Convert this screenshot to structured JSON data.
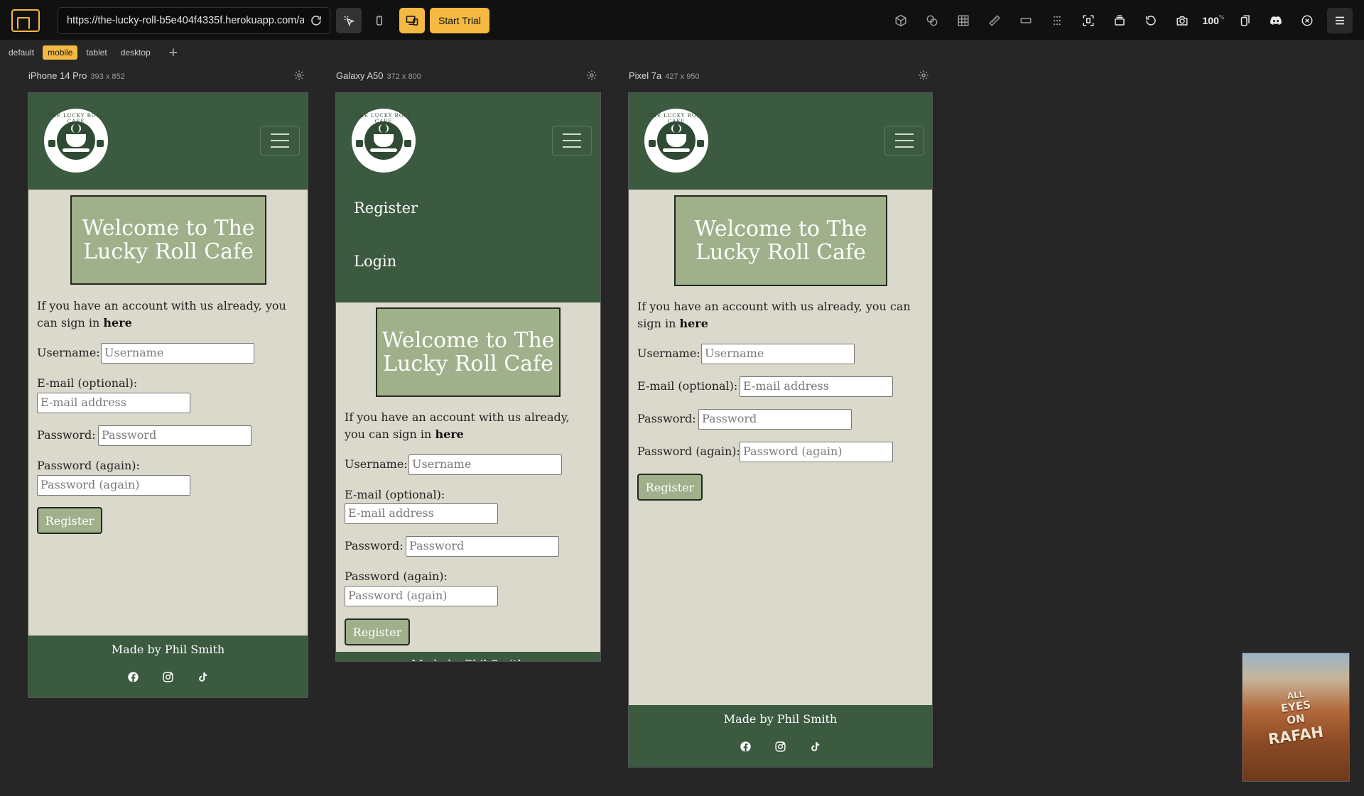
{
  "toolbar": {
    "url": "https://the-lucky-roll-b5e404f4335f.herokuapp.com/a",
    "start_trial": "Start Trial",
    "zoom": "100",
    "zoom_unit": "%"
  },
  "tabs": [
    {
      "label": "default",
      "active": false
    },
    {
      "label": "mobile",
      "active": true
    },
    {
      "label": "tablet",
      "active": false
    },
    {
      "label": "desktop",
      "active": false
    }
  ],
  "devices": [
    {
      "name": "iPhone 14 Pro",
      "dims": "393 x 852"
    },
    {
      "name": "Galaxy A50",
      "dims": "372 x 800"
    },
    {
      "name": "Pixel 7a",
      "dims": "427 x 950"
    }
  ],
  "site": {
    "logo_text": "THE LUCKY ROLL CAFE",
    "welcome": "Welcome to The Lucky Roll Cafe",
    "intro": "If you have an account with us already, you can sign in",
    "intro_link": "here",
    "username_label": "Username:",
    "username_placeholder": "Username",
    "email_label": "E-mail (optional):",
    "email_placeholder": "E-mail address",
    "password_label": "Password:",
    "password_placeholder": "Password",
    "password2_label": "Password (again):",
    "password2_placeholder": "Password (again)",
    "register_button": "Register",
    "footer": "Made by Phil Smith",
    "nav_register": "Register",
    "nav_login": "Login"
  },
  "thumbnail": {
    "line1": "ALL",
    "line2": "EYES",
    "line3": "ON",
    "line4": "RAFAH"
  },
  "colors": {
    "accent": "#f4b942",
    "site_green": "#3b5a40",
    "site_sage": "#9fb08a",
    "site_bg": "#dbd8cc"
  }
}
